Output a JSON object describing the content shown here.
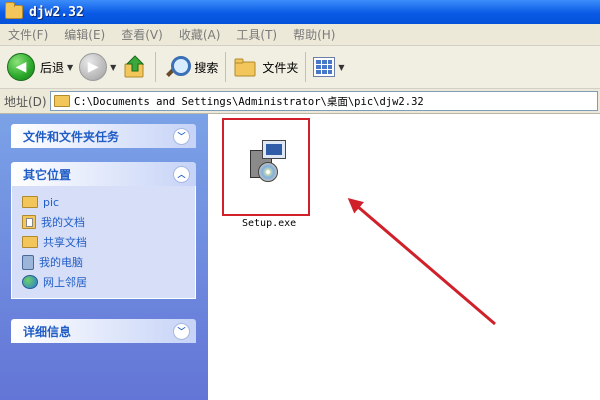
{
  "window": {
    "title": "djw2.32"
  },
  "menubar": {
    "items": [
      "文件(F)",
      "编辑(E)",
      "查看(V)",
      "收藏(A)",
      "工具(T)",
      "帮助(H)"
    ]
  },
  "toolbar": {
    "back_label": "后退",
    "search_label": "搜索",
    "folders_label": "文件夹"
  },
  "addressbar": {
    "label": "地址(D)",
    "path": "C:\\Documents and Settings\\Administrator\\桌面\\pic\\djw2.32"
  },
  "taskpane": {
    "file_tasks_title": "文件和文件夹任务",
    "other_places_title": "其它位置",
    "other_places": [
      "pic",
      "我的文档",
      "共享文档",
      "我的电脑",
      "网上邻居"
    ],
    "details_title": "详细信息"
  },
  "content": {
    "files": [
      {
        "name": "Setup.exe"
      }
    ]
  },
  "colors": {
    "highlight_box": "#d0202a",
    "annotation_arrow": "#d0202a"
  }
}
